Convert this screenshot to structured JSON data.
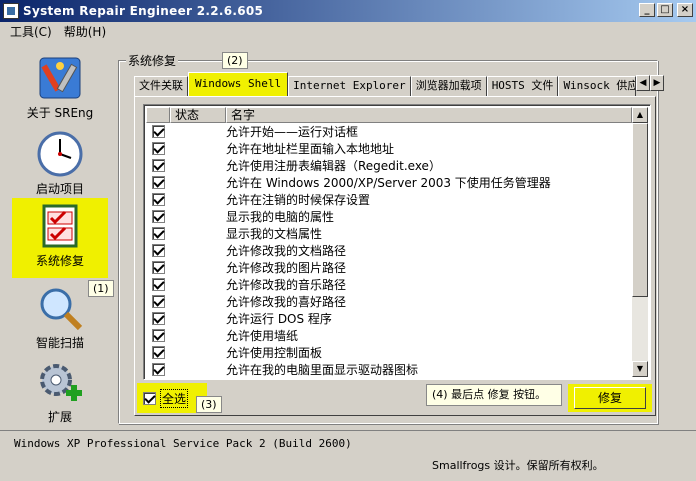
{
  "window": {
    "title": "System Repair Engineer 2.2.6.605",
    "minimize": "_",
    "maximize": "□",
    "close": "×"
  },
  "menu": {
    "items": [
      {
        "label": "工具(C)"
      },
      {
        "label": "帮助(H)"
      }
    ]
  },
  "sidebar": {
    "items": [
      {
        "label": "关于 SREng",
        "icon": "tools-icon"
      },
      {
        "label": "启动项目",
        "icon": "clock-icon"
      },
      {
        "label": "系统修复",
        "icon": "checklist-icon"
      },
      {
        "label": "智能扫描",
        "icon": "magnifier-icon"
      },
      {
        "label": "扩展",
        "icon": "gear-plus-icon"
      }
    ]
  },
  "annotations": {
    "a1": "(1)",
    "a2": "(2)",
    "a3": "(3)",
    "a4": "(4) 最后点 修复 按钮。"
  },
  "group": {
    "title": "系统修复"
  },
  "tabs": [
    {
      "label": "文件关联"
    },
    {
      "label": "Windows Shell"
    },
    {
      "label": "Internet Explorer"
    },
    {
      "label": "浏览器加载项"
    },
    {
      "label": "HOSTS 文件"
    },
    {
      "label": "Winsock 供应"
    }
  ],
  "tab_scroll": {
    "left": "◀",
    "right": "▶"
  },
  "list": {
    "columns": [
      {
        "label": ""
      },
      {
        "label": "状态"
      },
      {
        "label": "名字"
      }
    ],
    "rows": [
      {
        "name": "允许开始——运行对话框"
      },
      {
        "name": "允许在地址栏里面输入本地地址"
      },
      {
        "name": "允许使用注册表编辑器（Regedit.exe）"
      },
      {
        "name": "允许在 Windows 2000/XP/Server 2003 下使用任务管理器"
      },
      {
        "name": "允许在注销的时候保存设置"
      },
      {
        "name": "显示我的电脑的属性"
      },
      {
        "name": "显示我的文档属性"
      },
      {
        "name": "允许修改我的文档路径"
      },
      {
        "name": "允许修改我的图片路径"
      },
      {
        "name": "允许修改我的音乐路径"
      },
      {
        "name": "允许修改我的喜好路径"
      },
      {
        "name": "允许运行 DOS 程序"
      },
      {
        "name": "允许使用墙纸"
      },
      {
        "name": "允许使用控制面板"
      },
      {
        "name": "允许在我的电脑里面显示驱动器图标"
      }
    ],
    "scroll_up": "▲",
    "scroll_down": "▼"
  },
  "select_all": {
    "label": "全选"
  },
  "repair_button": {
    "label": "修复"
  },
  "status": {
    "os": "Windows XP Professional Service Pack 2 (Build 2600)",
    "copyright": "Smallfrogs 设计。保留所有权利。"
  },
  "colors": {
    "highlight": "#f0f000",
    "titlebar": "#0a246a",
    "face": "#d4d0c8"
  }
}
